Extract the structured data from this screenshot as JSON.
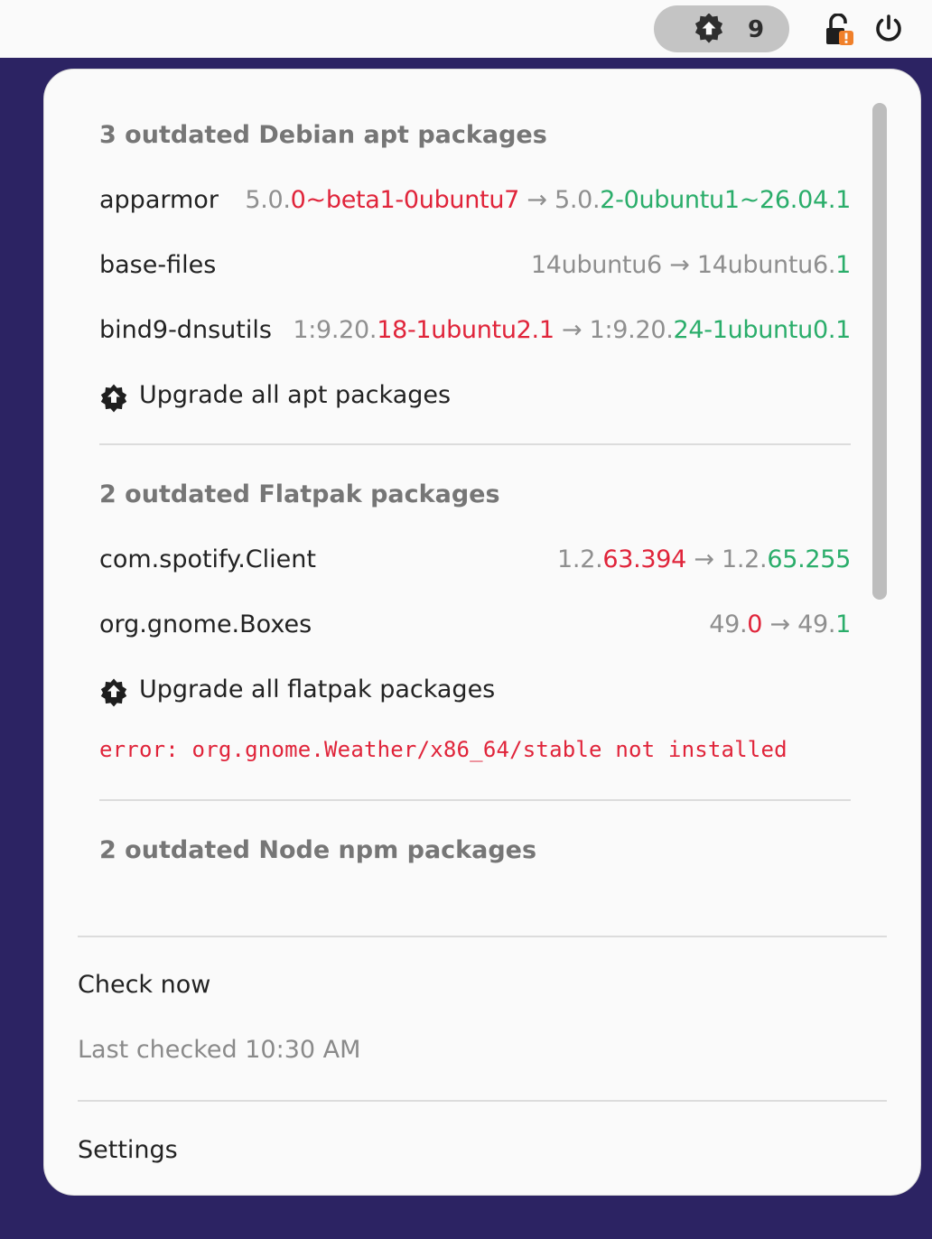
{
  "topbar": {
    "update_count": "9"
  },
  "icons": {
    "indicator": "package-upgrade-icon",
    "lock": "lock-warning-icon",
    "power": "power-icon",
    "upgrade": "package-upgrade-icon"
  },
  "colors": {
    "accent_red": "#e0243a",
    "accent_green": "#2aad6a",
    "background": "#2c2363"
  },
  "apt": {
    "title": "3 outdated Debian apt packages",
    "packages": [
      {
        "name": "apparmor",
        "old_common": "5.0.",
        "old_diff": "0~beta1-0ubuntu7",
        "new_common": "5.0.",
        "new_diff": "2-0ubuntu1~26.04.1"
      },
      {
        "name": "base-files",
        "old_common": "14ubuntu6",
        "old_diff": "",
        "new_common": "14ubuntu6.",
        "new_diff": "1"
      },
      {
        "name": "bind9-dnsutils",
        "old_common": "1:9.20.",
        "old_diff": "18-1ubuntu2.1",
        "new_common": "1:9.20.",
        "new_diff": "24-1ubuntu0.1"
      }
    ],
    "upgrade_label": "Upgrade all apt packages"
  },
  "flatpak": {
    "title": "2 outdated Flatpak packages",
    "packages": [
      {
        "name": "com.spotify.Client",
        "old_common": "1.2.",
        "old_diff": "63.394",
        "new_common": "1.2.",
        "new_diff": "65.255"
      },
      {
        "name": "org.gnome.Boxes",
        "old_common": "49.",
        "old_diff": "0",
        "new_common": "49.",
        "new_diff": "1"
      }
    ],
    "upgrade_label": "Upgrade all flatpak packages",
    "error": "error: org.gnome.Weather/x86_64/stable not installed"
  },
  "npm": {
    "title": "2 outdated Node npm packages"
  },
  "menu": {
    "check_now": "Check now",
    "last_checked": "Last checked 10:30 AM",
    "settings": "Settings"
  },
  "arrow": "→"
}
